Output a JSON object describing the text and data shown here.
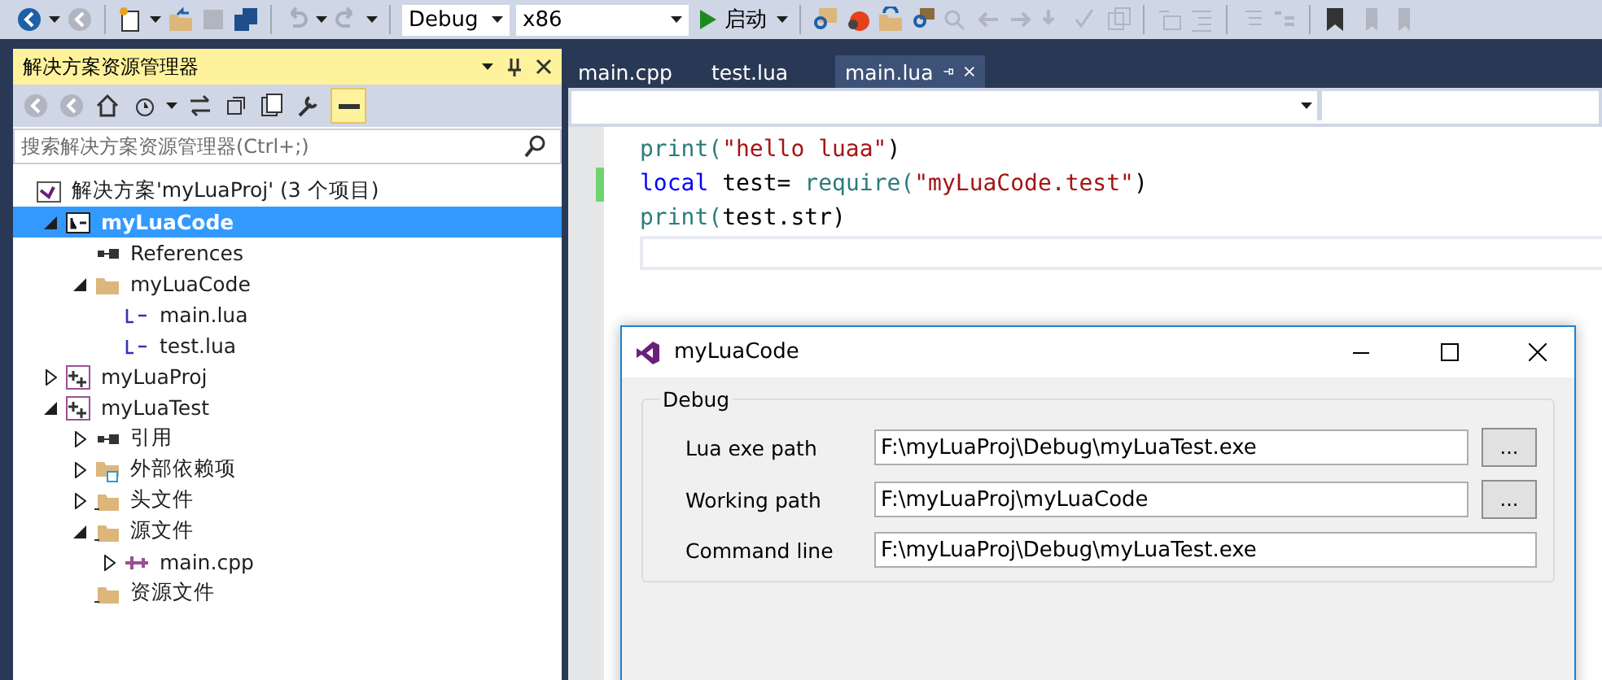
{
  "toolbar": {
    "configuration": "Debug",
    "platform": "x86",
    "start_button": "启动"
  },
  "solution_explorer": {
    "title": "解决方案资源管理器",
    "search": {
      "placeholder": "搜索解决方案资源管理器(Ctrl+;)"
    },
    "tree": [
      {
        "kind": "solution",
        "label": "解决方案'myLuaProj' (3 个项目)",
        "selected": false,
        "children": [
          {
            "kind": "lua-project",
            "label": "myLuaCode",
            "selected": true,
            "expanded": true,
            "children": [
              {
                "kind": "references",
                "label": "References",
                "selected": false
              },
              {
                "kind": "folder",
                "label": "myLuaCode",
                "selected": false,
                "expanded": true,
                "children": [
                  {
                    "kind": "lua-file",
                    "label": "main.lua",
                    "selected": false
                  },
                  {
                    "kind": "lua-file",
                    "label": "test.lua",
                    "selected": false
                  }
                ]
              }
            ]
          },
          {
            "kind": "cpp-project",
            "label": "myLuaProj",
            "selected": false,
            "expanded": false
          },
          {
            "kind": "cpp-project",
            "label": "myLuaTest",
            "selected": false,
            "expanded": true,
            "children": [
              {
                "kind": "references",
                "label": "引用",
                "selected": false,
                "expanded": false
              },
              {
                "kind": "ext-deps",
                "label": "外部依赖项",
                "selected": false,
                "expanded": false
              },
              {
                "kind": "filter",
                "label": "头文件",
                "selected": false,
                "expanded": false
              },
              {
                "kind": "filter",
                "label": "源文件",
                "selected": false,
                "expanded": true,
                "children": [
                  {
                    "kind": "cpp-file",
                    "label": "main.cpp",
                    "selected": false,
                    "expanded": false
                  }
                ]
              },
              {
                "kind": "filter",
                "label": "资源文件",
                "selected": false
              }
            ]
          }
        ]
      }
    ]
  },
  "editor": {
    "tabs": [
      {
        "label": "main.cpp",
        "selected": false
      },
      {
        "label": "test.lua",
        "selected": false
      },
      {
        "label": "main.lua",
        "selected": true
      }
    ],
    "lines": [
      {
        "changed": false,
        "tokens": [
          {
            "kind": "func",
            "text": "print("
          },
          {
            "kind": "string",
            "text": "\"hello luaa\""
          },
          {
            "kind": "plain",
            "text": ")"
          }
        ]
      },
      {
        "changed": true,
        "tokens": [
          {
            "kind": "keyword",
            "text": "local"
          },
          {
            "kind": "plain",
            "text": " test= "
          },
          {
            "kind": "func",
            "text": "require("
          },
          {
            "kind": "string",
            "text": "\"myLuaCode.test\""
          },
          {
            "kind": "plain",
            "text": ")"
          }
        ]
      },
      {
        "changed": false,
        "tokens": [
          {
            "kind": "func",
            "text": "print("
          },
          {
            "kind": "plain",
            "text": "test.str)"
          }
        ]
      }
    ]
  },
  "dialog": {
    "title": "myLuaCode",
    "group": "Debug",
    "rows": [
      {
        "label": "Lua exe path",
        "value": "F:\\myLuaProj\\Debug\\myLuaTest.exe",
        "button": "..."
      },
      {
        "label": "Working path",
        "value": "F:\\myLuaProj\\myLuaCode",
        "button": "..."
      },
      {
        "label": "Command line",
        "value": "F:\\myLuaProj\\Debug\\myLuaTest.exe"
      }
    ]
  }
}
